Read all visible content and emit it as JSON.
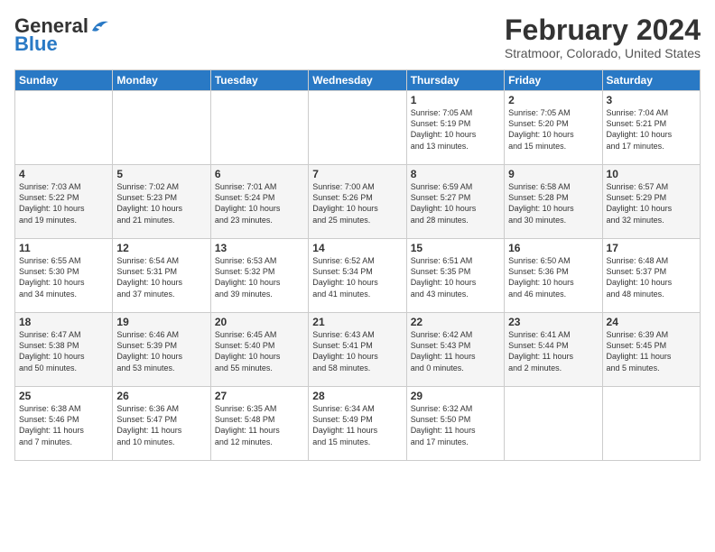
{
  "header": {
    "logo_general": "General",
    "logo_blue": "Blue",
    "main_title": "February 2024",
    "subtitle": "Stratmoor, Colorado, United States"
  },
  "calendar": {
    "days_of_week": [
      "Sunday",
      "Monday",
      "Tuesday",
      "Wednesday",
      "Thursday",
      "Friday",
      "Saturday"
    ],
    "weeks": [
      [
        {
          "day": "",
          "info": ""
        },
        {
          "day": "",
          "info": ""
        },
        {
          "day": "",
          "info": ""
        },
        {
          "day": "",
          "info": ""
        },
        {
          "day": "1",
          "info": "Sunrise: 7:05 AM\nSunset: 5:19 PM\nDaylight: 10 hours\nand 13 minutes."
        },
        {
          "day": "2",
          "info": "Sunrise: 7:05 AM\nSunset: 5:20 PM\nDaylight: 10 hours\nand 15 minutes."
        },
        {
          "day": "3",
          "info": "Sunrise: 7:04 AM\nSunset: 5:21 PM\nDaylight: 10 hours\nand 17 minutes."
        }
      ],
      [
        {
          "day": "4",
          "info": "Sunrise: 7:03 AM\nSunset: 5:22 PM\nDaylight: 10 hours\nand 19 minutes."
        },
        {
          "day": "5",
          "info": "Sunrise: 7:02 AM\nSunset: 5:23 PM\nDaylight: 10 hours\nand 21 minutes."
        },
        {
          "day": "6",
          "info": "Sunrise: 7:01 AM\nSunset: 5:24 PM\nDaylight: 10 hours\nand 23 minutes."
        },
        {
          "day": "7",
          "info": "Sunrise: 7:00 AM\nSunset: 5:26 PM\nDaylight: 10 hours\nand 25 minutes."
        },
        {
          "day": "8",
          "info": "Sunrise: 6:59 AM\nSunset: 5:27 PM\nDaylight: 10 hours\nand 28 minutes."
        },
        {
          "day": "9",
          "info": "Sunrise: 6:58 AM\nSunset: 5:28 PM\nDaylight: 10 hours\nand 30 minutes."
        },
        {
          "day": "10",
          "info": "Sunrise: 6:57 AM\nSunset: 5:29 PM\nDaylight: 10 hours\nand 32 minutes."
        }
      ],
      [
        {
          "day": "11",
          "info": "Sunrise: 6:55 AM\nSunset: 5:30 PM\nDaylight: 10 hours\nand 34 minutes."
        },
        {
          "day": "12",
          "info": "Sunrise: 6:54 AM\nSunset: 5:31 PM\nDaylight: 10 hours\nand 37 minutes."
        },
        {
          "day": "13",
          "info": "Sunrise: 6:53 AM\nSunset: 5:32 PM\nDaylight: 10 hours\nand 39 minutes."
        },
        {
          "day": "14",
          "info": "Sunrise: 6:52 AM\nSunset: 5:34 PM\nDaylight: 10 hours\nand 41 minutes."
        },
        {
          "day": "15",
          "info": "Sunrise: 6:51 AM\nSunset: 5:35 PM\nDaylight: 10 hours\nand 43 minutes."
        },
        {
          "day": "16",
          "info": "Sunrise: 6:50 AM\nSunset: 5:36 PM\nDaylight: 10 hours\nand 46 minutes."
        },
        {
          "day": "17",
          "info": "Sunrise: 6:48 AM\nSunset: 5:37 PM\nDaylight: 10 hours\nand 48 minutes."
        }
      ],
      [
        {
          "day": "18",
          "info": "Sunrise: 6:47 AM\nSunset: 5:38 PM\nDaylight: 10 hours\nand 50 minutes."
        },
        {
          "day": "19",
          "info": "Sunrise: 6:46 AM\nSunset: 5:39 PM\nDaylight: 10 hours\nand 53 minutes."
        },
        {
          "day": "20",
          "info": "Sunrise: 6:45 AM\nSunset: 5:40 PM\nDaylight: 10 hours\nand 55 minutes."
        },
        {
          "day": "21",
          "info": "Sunrise: 6:43 AM\nSunset: 5:41 PM\nDaylight: 10 hours\nand 58 minutes."
        },
        {
          "day": "22",
          "info": "Sunrise: 6:42 AM\nSunset: 5:43 PM\nDaylight: 11 hours\nand 0 minutes."
        },
        {
          "day": "23",
          "info": "Sunrise: 6:41 AM\nSunset: 5:44 PM\nDaylight: 11 hours\nand 2 minutes."
        },
        {
          "day": "24",
          "info": "Sunrise: 6:39 AM\nSunset: 5:45 PM\nDaylight: 11 hours\nand 5 minutes."
        }
      ],
      [
        {
          "day": "25",
          "info": "Sunrise: 6:38 AM\nSunset: 5:46 PM\nDaylight: 11 hours\nand 7 minutes."
        },
        {
          "day": "26",
          "info": "Sunrise: 6:36 AM\nSunset: 5:47 PM\nDaylight: 11 hours\nand 10 minutes."
        },
        {
          "day": "27",
          "info": "Sunrise: 6:35 AM\nSunset: 5:48 PM\nDaylight: 11 hours\nand 12 minutes."
        },
        {
          "day": "28",
          "info": "Sunrise: 6:34 AM\nSunset: 5:49 PM\nDaylight: 11 hours\nand 15 minutes."
        },
        {
          "day": "29",
          "info": "Sunrise: 6:32 AM\nSunset: 5:50 PM\nDaylight: 11 hours\nand 17 minutes."
        },
        {
          "day": "",
          "info": ""
        },
        {
          "day": "",
          "info": ""
        }
      ]
    ]
  }
}
